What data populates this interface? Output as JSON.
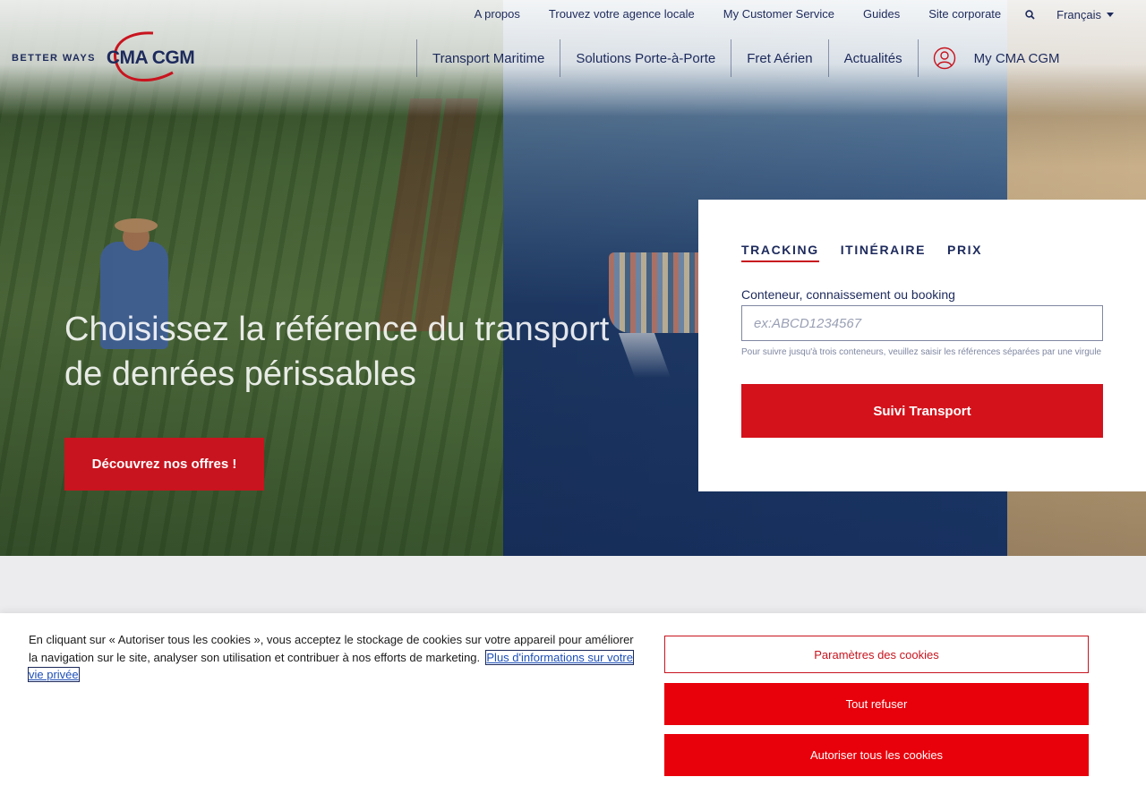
{
  "topbar": {
    "links": [
      "A propos",
      "Trouvez votre agence locale",
      "My Customer Service",
      "Guides",
      "Site corporate"
    ],
    "language": "Français"
  },
  "logo": {
    "tagline": "BETTER WAYS",
    "brand": "CMA CGM"
  },
  "nav": {
    "items": [
      "Transport Maritime",
      "Solutions Porte-à-Porte",
      "Fret Aérien",
      "Actualités"
    ],
    "account": "My CMA CGM"
  },
  "hero": {
    "title": "Choisissez la référence du transport de denrées périssables",
    "cta": "Découvrez nos offres !"
  },
  "tracking": {
    "tabs": [
      "TRACKING",
      "ITINÉRAIRE",
      "PRIX"
    ],
    "active_tab": "TRACKING",
    "field_label": "Conteneur, connaissement ou booking",
    "placeholder": "ex:ABCD1234567",
    "value": "",
    "hint": "Pour suivre jusqu'à trois conteneurs, veuillez saisir les références séparées par une virgule",
    "button": "Suivi Transport"
  },
  "cookie": {
    "text": "En cliquant sur « Autoriser tous les cookies », vous acceptez le stockage de cookies sur votre appareil pour améliorer la navigation sur le site, analyser son utilisation et contribuer à nos efforts de marketing.",
    "link": "Plus d'informations sur votre vie privée",
    "settings_button": "Paramètres des cookies",
    "refuse_button": "Tout refuser",
    "accept_button": "Autoriser tous les cookies"
  },
  "colors": {
    "brand_red": "#c8141e",
    "cookie_red": "#e8000b",
    "navy": "#1d2a5c"
  },
  "icons": [
    "search-icon",
    "chevron-down-icon",
    "user-icon"
  ]
}
